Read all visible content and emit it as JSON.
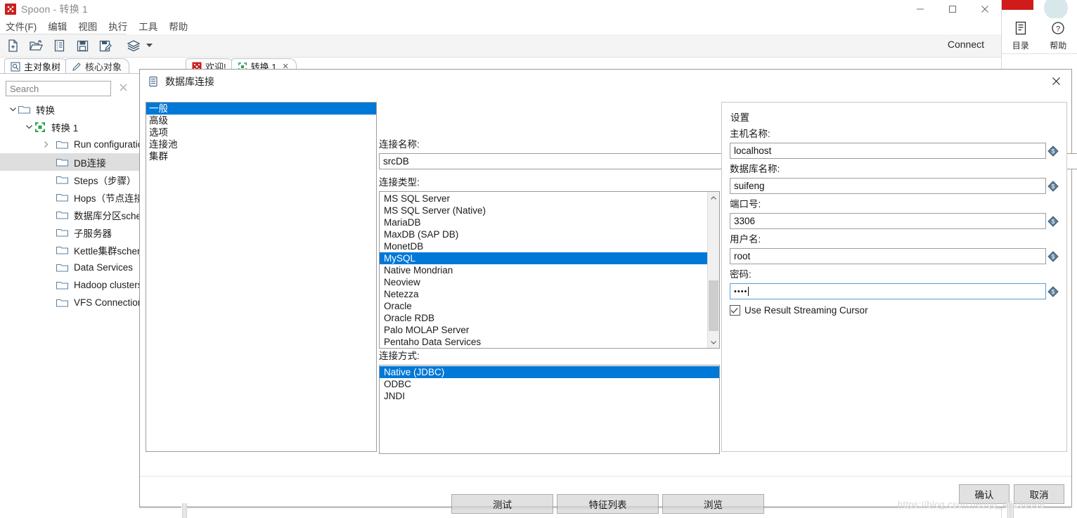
{
  "window": {
    "title": "Spoon - 转换 1",
    "app_icon": "spoon-icon",
    "minimize": "—",
    "maximize": "□",
    "close": "✕"
  },
  "menubar": {
    "items": [
      {
        "label": "文件(F)"
      },
      {
        "label": "编辑"
      },
      {
        "label": "视图"
      },
      {
        "label": "执行"
      },
      {
        "label": "工具"
      },
      {
        "label": "帮助"
      }
    ]
  },
  "toolbar": {
    "icons": [
      {
        "name": "new-file-icon"
      },
      {
        "name": "open-folder-icon"
      },
      {
        "name": "list-icon"
      },
      {
        "name": "save-icon"
      },
      {
        "name": "save-as-icon"
      },
      {
        "name": "layers-icon"
      },
      {
        "name": "chevron-down-icon"
      }
    ],
    "connect_label": "Connect"
  },
  "view_tabs": {
    "left": [
      {
        "label": "主对象树",
        "icon": "tree-view-icon",
        "active": true
      },
      {
        "label": "核心对象",
        "icon": "pencil-icon",
        "active": false
      }
    ],
    "right": [
      {
        "label": "欢迎!",
        "icon": "spoon-icon",
        "active": false,
        "closable": false
      },
      {
        "label": "转换 1",
        "icon": "transformation-icon",
        "active": true,
        "closable": true,
        "close_glyph": "✕"
      }
    ]
  },
  "sidebar": {
    "search": {
      "placeholder": "Search",
      "value": "",
      "clear_glyph": "✕"
    },
    "tree": [
      {
        "label": "转换",
        "indent": 0,
        "twist": "v",
        "icon": "folder-icon",
        "selected": false
      },
      {
        "label": "转换 1",
        "indent": 1,
        "twist": "v",
        "icon": "transformation-icon",
        "selected": false
      },
      {
        "label": "Run configurations",
        "indent": 2,
        "twist": ">",
        "icon": "folder-icon",
        "selected": false
      },
      {
        "label": "DB连接",
        "indent": 2,
        "twist": "",
        "icon": "folder-icon",
        "selected": true
      },
      {
        "label": "Steps（步骤）",
        "indent": 2,
        "twist": "",
        "icon": "folder-icon",
        "selected": false
      },
      {
        "label": "Hops（节点连接）",
        "indent": 2,
        "twist": "",
        "icon": "folder-icon",
        "selected": false
      },
      {
        "label": "数据库分区schemas",
        "indent": 2,
        "twist": "",
        "icon": "folder-icon",
        "selected": false
      },
      {
        "label": "子服务器",
        "indent": 2,
        "twist": "",
        "icon": "folder-icon",
        "selected": false
      },
      {
        "label": "Kettle集群schemas",
        "indent": 2,
        "twist": "",
        "icon": "folder-icon",
        "selected": false
      },
      {
        "label": "Data Services",
        "indent": 2,
        "twist": "",
        "icon": "folder-icon",
        "selected": false
      },
      {
        "label": "Hadoop clusters",
        "indent": 2,
        "twist": "",
        "icon": "folder-icon",
        "selected": false
      },
      {
        "label": "VFS Connections",
        "indent": 2,
        "twist": "",
        "icon": "folder-icon",
        "selected": false
      }
    ]
  },
  "right_strip": {
    "items": [
      {
        "label": "目录",
        "icon": "contents-icon"
      },
      {
        "label": "帮助",
        "icon": "help-circle-icon"
      }
    ]
  },
  "dialog": {
    "title": "数据库连接",
    "title_icon": "database-icon",
    "close_glyph": "✕",
    "categories": [
      {
        "label": "一般",
        "selected": true
      },
      {
        "label": "高级",
        "selected": false
      },
      {
        "label": "选项",
        "selected": false
      },
      {
        "label": "连接池",
        "selected": false
      },
      {
        "label": "集群",
        "selected": false
      }
    ],
    "connection_name": {
      "label": "连接名称:",
      "value": "srcDB",
      "placeholder": ""
    },
    "connection_type": {
      "label": "连接类型:",
      "options": [
        {
          "label": "MS SQL Server",
          "selected": false
        },
        {
          "label": "MS SQL Server (Native)",
          "selected": false
        },
        {
          "label": "MariaDB",
          "selected": false
        },
        {
          "label": "MaxDB (SAP DB)",
          "selected": false
        },
        {
          "label": "MonetDB",
          "selected": false
        },
        {
          "label": "MySQL",
          "selected": true
        },
        {
          "label": "Native Mondrian",
          "selected": false
        },
        {
          "label": "Neoview",
          "selected": false
        },
        {
          "label": "Netezza",
          "selected": false
        },
        {
          "label": "Oracle",
          "selected": false
        },
        {
          "label": "Oracle RDB",
          "selected": false
        },
        {
          "label": "Palo MOLAP Server",
          "selected": false
        },
        {
          "label": "Pentaho Data Services",
          "selected": false
        }
      ],
      "scroll_up_glyph": "⌃",
      "scroll_down_glyph": "⌄"
    },
    "access_method": {
      "label": "连接方式:",
      "options": [
        {
          "label": "Native (JDBC)",
          "selected": true
        },
        {
          "label": "ODBC",
          "selected": false
        },
        {
          "label": "JNDI",
          "selected": false
        }
      ]
    },
    "settings": {
      "title": "设置",
      "fields": [
        {
          "label": "主机名称:",
          "value": "localhost",
          "var_icon": "variable-dollar-icon",
          "focused": false,
          "password": false
        },
        {
          "label": "数据库名称:",
          "value": "suifeng",
          "var_icon": "variable-dollar-icon",
          "focused": false,
          "password": false
        },
        {
          "label": "端口号:",
          "value": "3306",
          "var_icon": "variable-dollar-icon",
          "focused": false,
          "password": false
        },
        {
          "label": "用户名:",
          "value": "root",
          "var_icon": "variable-dollar-icon",
          "focused": false,
          "password": false
        },
        {
          "label": "密码:",
          "value": "••••",
          "var_icon": "variable-dollar-icon",
          "focused": true,
          "password": true
        }
      ],
      "checkbox": {
        "label": "Use Result Streaming Cursor",
        "checked": true
      }
    },
    "buttons": [
      {
        "label": "测试",
        "name": "test-button"
      },
      {
        "label": "特征列表",
        "name": "feature-list-button"
      },
      {
        "label": "浏览",
        "name": "explore-button"
      }
    ],
    "confirm": {
      "label": "确认"
    },
    "cancel": {
      "label": "取消"
    }
  },
  "watermark": {
    "text": "https://blog.csdn.net/qq_42288668"
  },
  "colors": {
    "selection_blue": "#0078d7",
    "button_face": "#e1e1e1",
    "tree_selected": "#dedede",
    "border": "#9d9d9d"
  }
}
